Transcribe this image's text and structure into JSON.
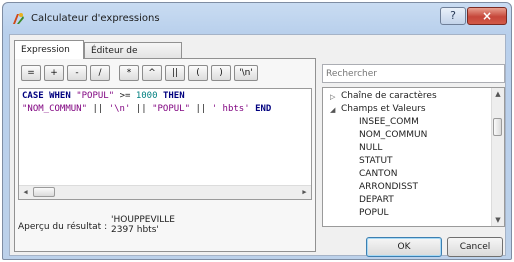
{
  "window": {
    "title": "Calculateur d'expressions",
    "help_label": "?",
    "close_label": "×"
  },
  "tabs": [
    {
      "label": "Expression"
    },
    {
      "label": "Éditeur de fonction"
    }
  ],
  "operators": [
    "=",
    "+",
    "-",
    "/",
    "*",
    "^",
    "||",
    "(",
    ")",
    "'\\n'"
  ],
  "editor": {
    "line1": {
      "kw1": "CASE WHEN",
      "field": "\"POPUL\"",
      "op": ">=",
      "num": "1000",
      "kw2": "THEN"
    },
    "line2": {
      "field1": "\"NOM_COMMUN\"",
      "op1": "||",
      "str1": "'\\n'",
      "op2": "||",
      "field2": "\"POPUL\"",
      "op3": "||",
      "str2": "' hbts'",
      "kw": "END"
    }
  },
  "preview": {
    "label": "Aperçu du résultat :",
    "value": "'HOUPPEVILLE\n2397 hbts'"
  },
  "search": {
    "placeholder": "Rechercher"
  },
  "tree": {
    "groups": [
      {
        "label": "Chaîne de caractères",
        "expanded": false
      },
      {
        "label": "Champs et Valeurs",
        "expanded": true
      }
    ],
    "fields": [
      "INSEE_COMM",
      "NOM_COMMUN",
      "NULL",
      "STATUT",
      "CANTON",
      "ARRONDISST",
      "DEPART",
      "POPUL"
    ]
  },
  "buttons": {
    "ok": "OK",
    "cancel": "Cancel"
  }
}
